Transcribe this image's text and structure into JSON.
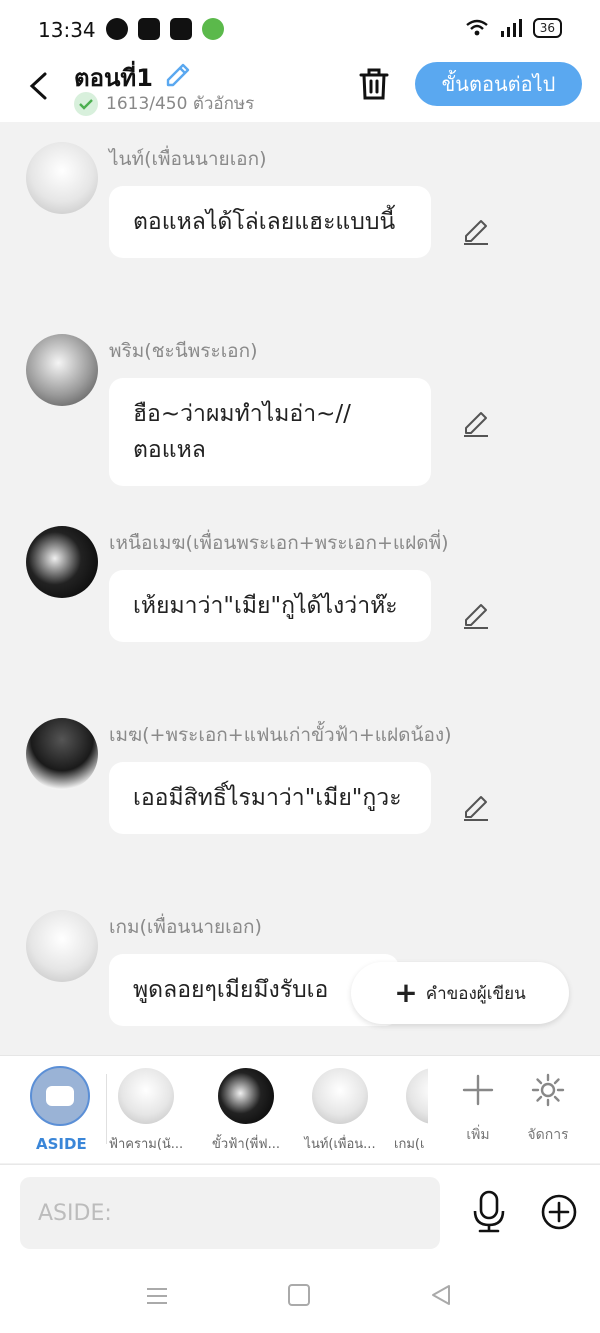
{
  "status_bar": {
    "time": "13:34",
    "battery": "36"
  },
  "header": {
    "title": "ตอนที่1",
    "char_count": "1613/450 ตัวอักษร",
    "next_label": "ขั้นตอนต่อไป"
  },
  "messages": [
    {
      "speaker": "ไนท์(เพื่อนนายเอก)",
      "text": "ตอแหลได้โล่เลยแฮะแบบนี้",
      "avatar": "light"
    },
    {
      "speaker": "พริม(ชะนีพระเอก)",
      "text": "ฮือ~ว่าผมทำไมอ่า~//ตอแหล",
      "avatar": "mid"
    },
    {
      "speaker": "เหนือเมฆ(เพื่อนพระเอก+พระเอก+แฝดพี่)",
      "text": "เห้ยมาว่า\"เมีย\"กูได้ไงว่าห๊ะ",
      "avatar": "dark"
    },
    {
      "speaker": "เมฆ(+พระเอก+แฟนเก่าขั้วฟ้า+แฝดน้อง)",
      "text": "เออมีสิทธิ์ไรมาว่า\"เมีย\"กูวะ",
      "avatar": "person"
    },
    {
      "speaker": "เกม(เพื่อนนายเอก)",
      "text": "พูดลอยๆเมียมึงรับเอ",
      "avatar": "light"
    }
  ],
  "author_note": {
    "label": "คำของผู้เขียน"
  },
  "characters": {
    "aside_label": "ASIDE",
    "items": [
      {
        "name": "ฟ้าคราม(นั...",
        "avatar": "light"
      },
      {
        "name": "ขั้วฟ้า(พี่ฟ...",
        "avatar": "dark"
      },
      {
        "name": "ไนท์(เพื่อน...",
        "avatar": "light"
      },
      {
        "name": "เกม(เ",
        "avatar": "light"
      }
    ],
    "add_label": "เพิ่ม",
    "manage_label": "จัดการ"
  },
  "input": {
    "placeholder": "ASIDE:"
  },
  "colors": {
    "accent": "#5aa8f0",
    "aside_label": "#3a86d8",
    "background": "#f2f2f2"
  }
}
